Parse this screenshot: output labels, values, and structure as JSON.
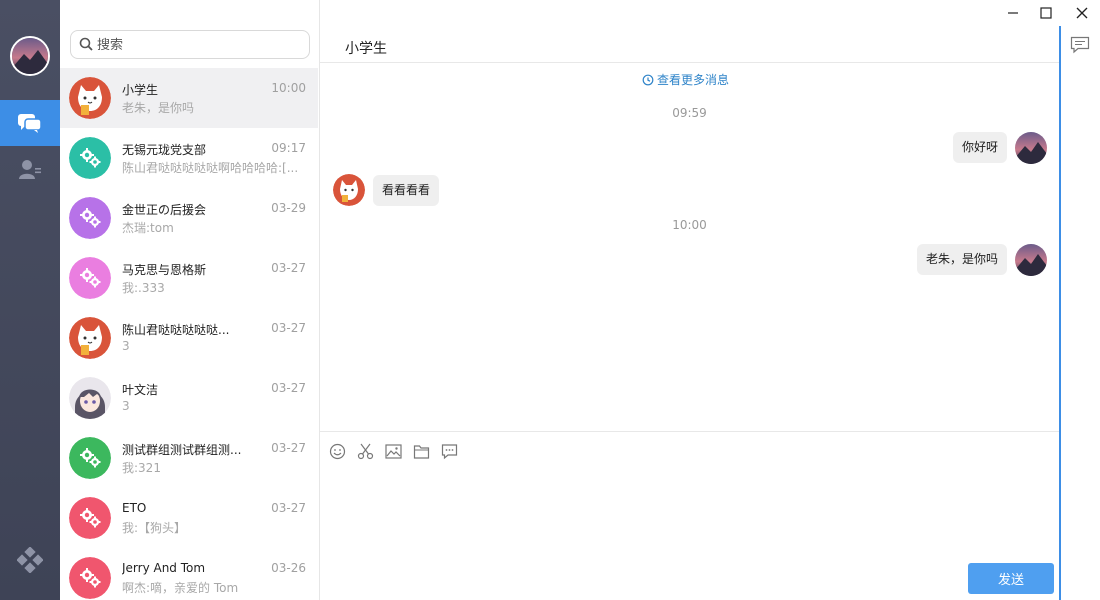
{
  "window": {
    "title": "小学生"
  },
  "search": {
    "placeholder": "搜索"
  },
  "conversations": [
    {
      "name": "小学生",
      "time": "10:00",
      "preview": "老朱，是你吗",
      "avatar": "cat-avatar",
      "active": true
    },
    {
      "name": "无锡元珑党支部",
      "time": "09:17",
      "preview": "陈山君哒哒哒哒哒啊哈哈哈哈:[...",
      "avatar": "group-icon",
      "color": "#2bbfa6"
    },
    {
      "name": "金世正の后援会",
      "time": "03-29",
      "preview": "杰瑞:tom",
      "avatar": "group-icon",
      "color": "#b772e8"
    },
    {
      "name": "马克思与恩格斯",
      "time": "03-27",
      "preview": "我:.333",
      "avatar": "group-icon",
      "color": "#ea7ee0"
    },
    {
      "name": "陈山君哒哒哒哒哒...",
      "time": "03-27",
      "preview": "3",
      "avatar": "cat-avatar"
    },
    {
      "name": "叶文洁",
      "time": "03-27",
      "preview": "3",
      "avatar": "anime-girl-avatar"
    },
    {
      "name": "测试群组测试群组测...",
      "time": "03-27",
      "preview": "我:321",
      "avatar": "group-icon",
      "color": "#3cb85e"
    },
    {
      "name": "ETO",
      "time": "03-27",
      "preview": "我:【狗头】",
      "avatar": "group-icon",
      "color": "#f0566e"
    },
    {
      "name": "Jerry And Tom",
      "time": "03-26",
      "preview": "啊杰:嘀，亲爱的 Tom",
      "avatar": "group-icon",
      "color": "#f0566e"
    }
  ],
  "chat": {
    "title": "小学生",
    "more_messages": "查看更多消息",
    "messages": [
      {
        "type": "time",
        "text": "09:59"
      },
      {
        "type": "sent",
        "text": "你好呀"
      },
      {
        "type": "received",
        "text": "看看看看"
      },
      {
        "type": "time",
        "text": "10:00"
      },
      {
        "type": "sent",
        "text": "老朱，是你吗"
      }
    ]
  },
  "composer": {
    "tools": [
      "emoji-icon",
      "scissors-icon",
      "image-icon",
      "folder-icon",
      "chat-history-icon"
    ],
    "send_label": "发送"
  },
  "colors": {
    "accent": "#3d8ee6",
    "send": "#4f9ff0",
    "rail": "#454a5e"
  }
}
